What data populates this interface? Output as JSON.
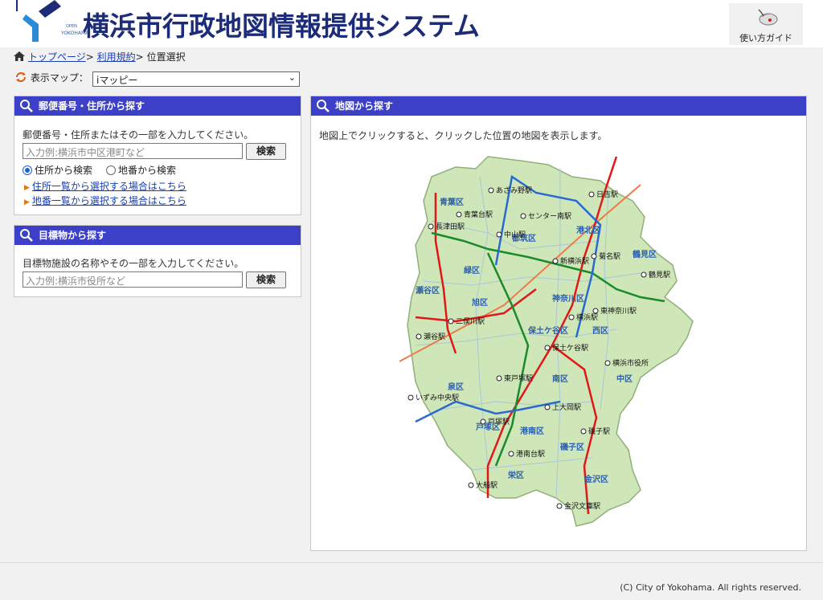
{
  "header": {
    "logo_open": "OPEN",
    "logo_city": "YOKOHAMA",
    "title": "横浜市行政地図情報提供システム",
    "guide_label": "使い方ガイド"
  },
  "breadcrumb": {
    "top": "トップページ",
    "terms": "利用規約",
    "sep": ">",
    "current": "位置選択"
  },
  "map_select": {
    "label": "表示マップ：",
    "value": "iマッピー"
  },
  "address_panel": {
    "title": "郵便番号・住所から探す",
    "hint": "郵便番号・住所またはその一部を入力してください。",
    "placeholder": "入力例:横浜市中区港町など",
    "search": "検索",
    "radio_address": "住所から検索",
    "radio_lot": "地番から検索",
    "link_address": "住所一覧から選択する場合はこちら",
    "link_lot": "地番一覧から選択する場合はこちら"
  },
  "landmark_panel": {
    "title": "目標物から探す",
    "hint": "目標物施設の名称やその一部を入力してください。",
    "placeholder": "入力例:横浜市役所など",
    "search": "検索"
  },
  "map_panel": {
    "title": "地図から探す",
    "hint": "地図上でクリックすると、クリックした位置の地図を表示します。"
  },
  "wards": [
    "青葉区",
    "都筑区",
    "港北区",
    "鶴見区",
    "緑区",
    "神奈川区",
    "瀬谷区",
    "旭区",
    "保土ケ谷区",
    "西区",
    "中区",
    "泉区",
    "南区",
    "戸塚区",
    "港南区",
    "磯子区",
    "栄区",
    "金沢区"
  ],
  "stations": [
    "あざみ野駅",
    "日吉駅",
    "青葉台駅",
    "センター南駅",
    "長津田駅",
    "中山駅",
    "新横浜駅",
    "菊名駅",
    "鶴見駅",
    "東神奈川駅",
    "二俣川駅",
    "横浜駅",
    "瀬谷駅",
    "保土ケ谷駅",
    "横浜市役所",
    "東戸塚駅",
    "いずみ中央駅",
    "上大岡駅",
    "戸塚駅",
    "磯子駅",
    "港南台駅",
    "大船駅",
    "金沢文庫駅"
  ],
  "footer": "(C) City of Yokohama. All rights reserved.",
  "colors": {
    "header_bar": "#3c3fc7",
    "title": "#1c2c79",
    "map_land": "#cfe6b8"
  }
}
